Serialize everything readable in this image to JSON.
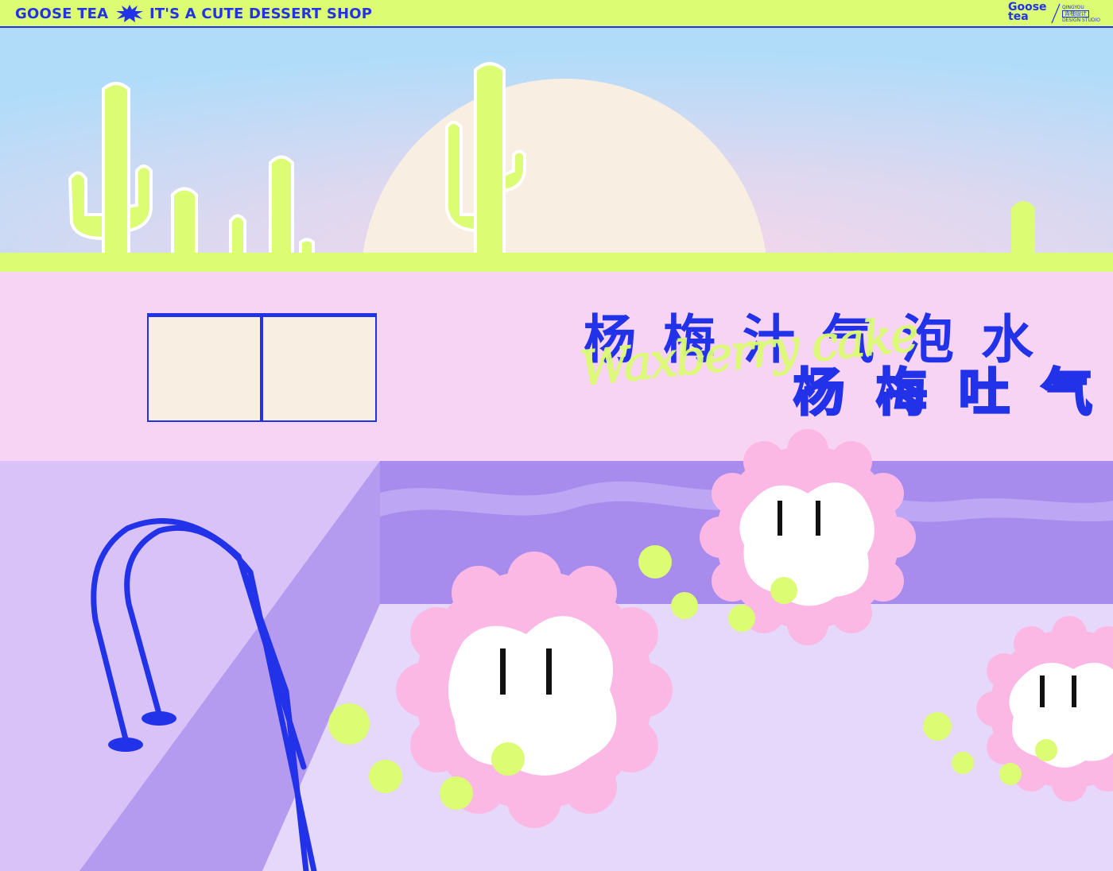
{
  "header": {
    "brand": "GOOSE TEA",
    "tagline": "IT'S A CUTE DESSERT SHOP",
    "logo_word": "Goose tea",
    "logo_studio_en": "QINGYOU",
    "logo_studio_cn": "青柚设计",
    "logo_studio_sub": "DESIGN STUDIO"
  },
  "poster": {
    "title_cn": "杨梅汁气泡水",
    "subtitle_cn": "杨梅吐气",
    "script_en": "Waxberry cake"
  },
  "colors": {
    "accent_blue": "#2232e8",
    "lime": "#dcfc74",
    "pink_wall": "#f8d4f4",
    "sky": "#b0dcfa",
    "pool_purple": "#a78ced"
  },
  "icons": [
    "star-burst-icon",
    "cactus",
    "sun",
    "window",
    "pool-ladder",
    "bubble-character"
  ]
}
